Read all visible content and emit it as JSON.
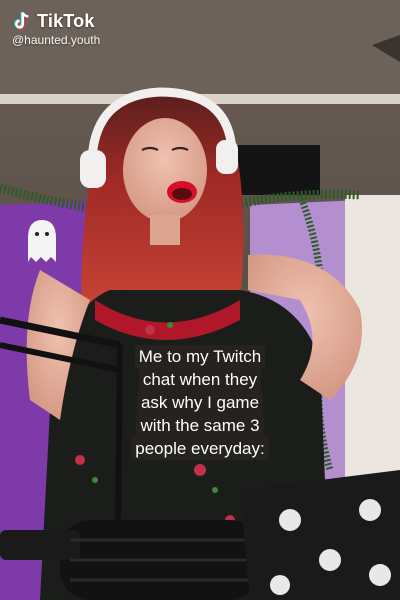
{
  "watermark": {
    "brand": "TikTok",
    "handle": "@haunted.youth",
    "logo_icon": "tiktok-note-icon"
  },
  "caption": {
    "lines": [
      "Me to my Twitch",
      "chat when they",
      "ask why I game",
      "with the same 3",
      "people everyday:"
    ]
  },
  "colors": {
    "hair": "#b8322f",
    "lips": "#d6102a",
    "headphones": "#f2f0ee",
    "wall": "#5a4f48",
    "backdrop": "#8a3fb8",
    "tinsel": "#2f5a2a"
  },
  "icons": [
    "tiktok-note-icon",
    "ghost-icon"
  ]
}
